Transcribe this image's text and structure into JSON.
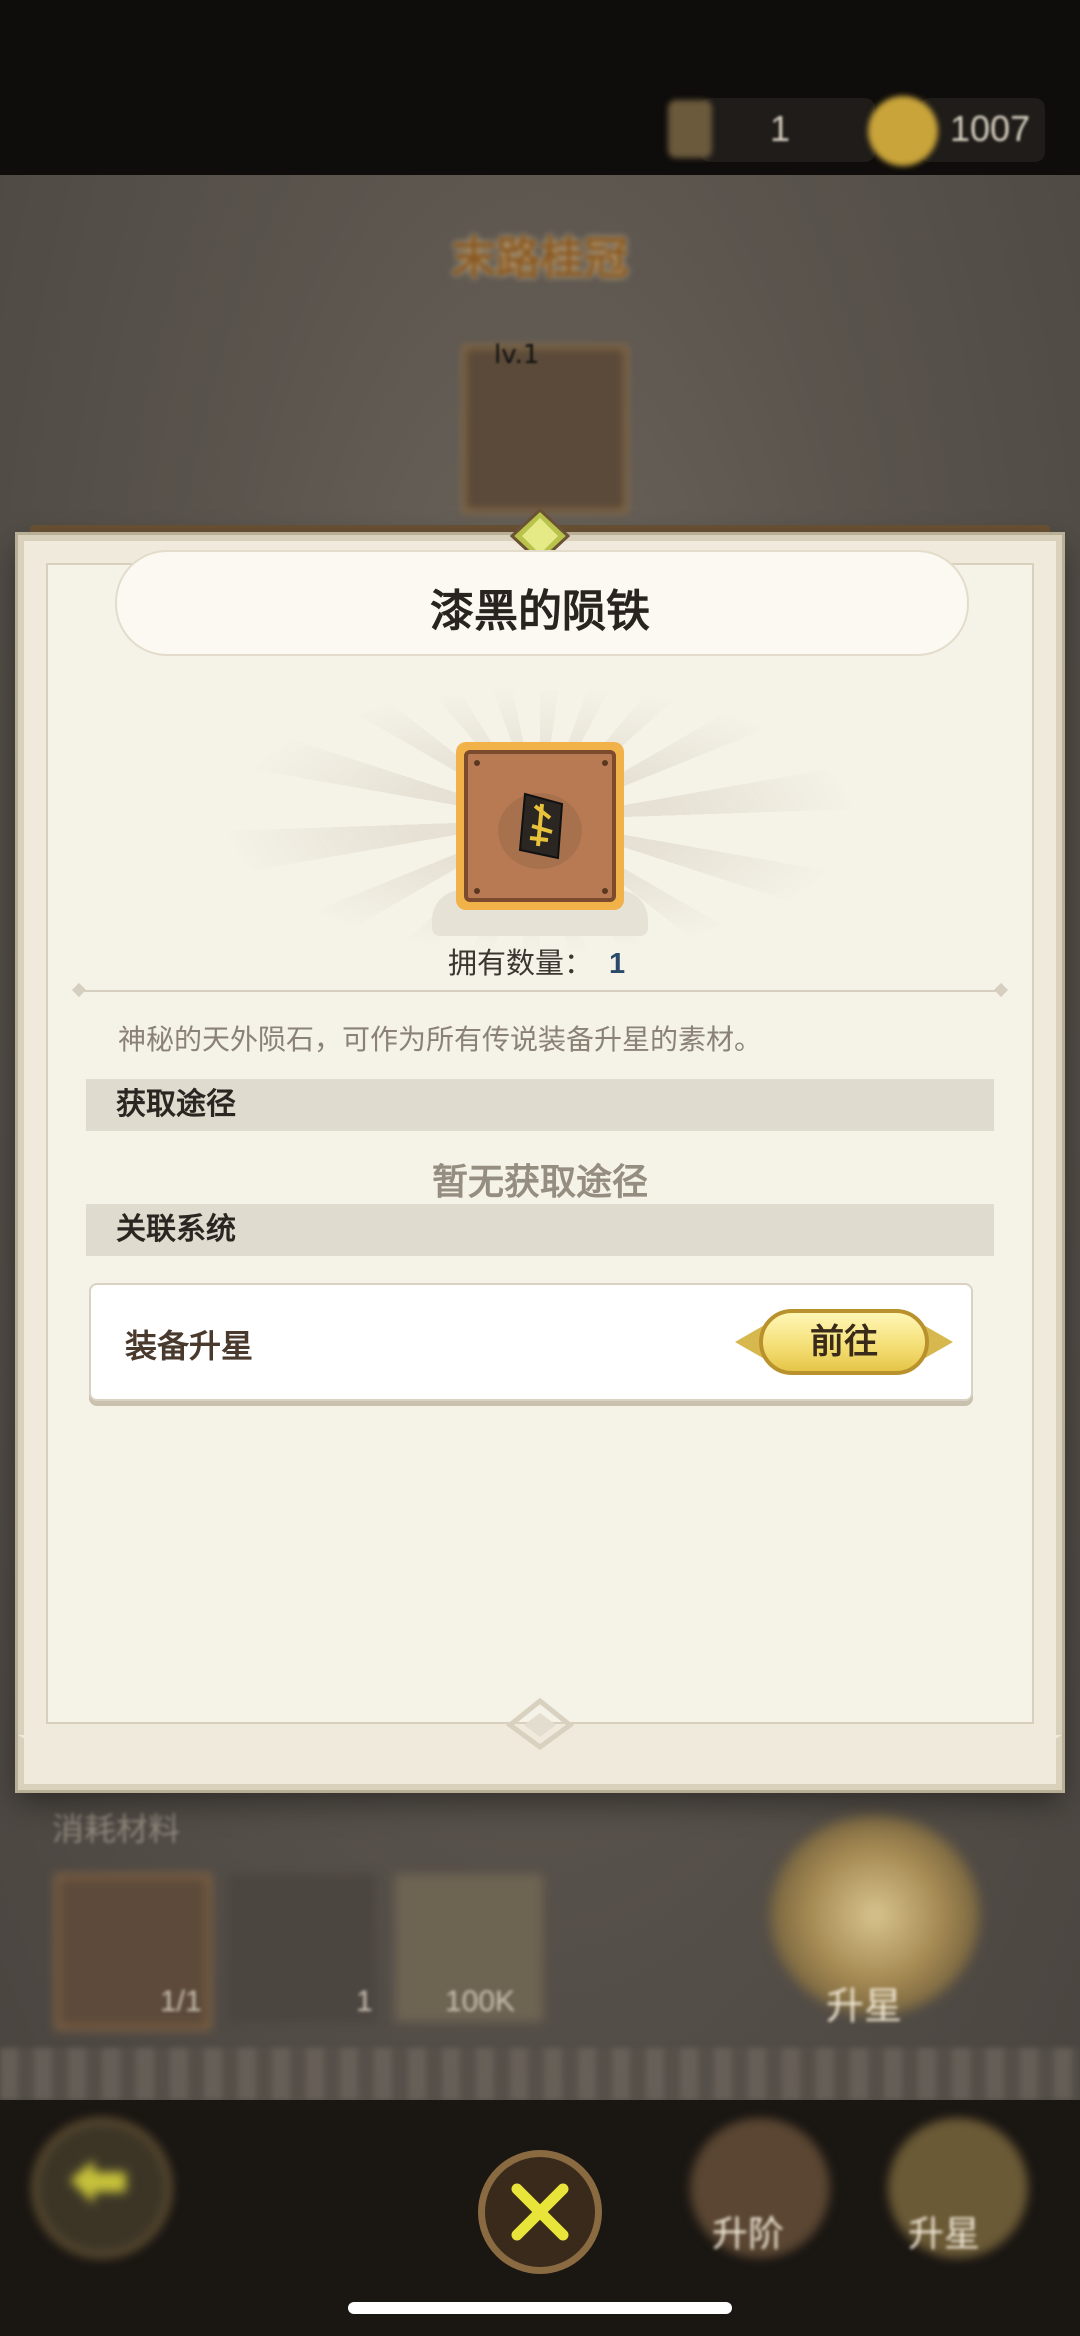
{
  "resources": [
    {
      "name": "stamina",
      "value": "1"
    },
    {
      "name": "coins",
      "value": "1007"
    }
  ],
  "background": {
    "title": "末路桂冠",
    "hero_level": "lv.1",
    "section_label": "消耗材料",
    "materials": [
      {
        "name": "hero-shard",
        "count": "1/1"
      },
      {
        "name": "meteorite",
        "count": "1"
      },
      {
        "name": "gold",
        "count": "100K"
      }
    ],
    "star_up_emblem_label": "升星"
  },
  "modal": {
    "title": "漆黑的陨铁",
    "owned_label": "拥有数量：",
    "owned_count": "1",
    "description": "神秘的天外陨石，可作为所有传说装备升星的素材。",
    "acquire_header": "获取途径",
    "acquire_empty": "暂无获取途径",
    "related_header": "关联系统",
    "related_items": [
      {
        "label": "装备升星",
        "button": "前往"
      }
    ]
  },
  "bottom_nav": {
    "back_icon": "arrow-back-icon",
    "close_icon": "close-x-icon",
    "advance_label": "升阶",
    "star_label": "升星"
  },
  "colors": {
    "panel": "#efeadb",
    "item_frame": "#f2b24a",
    "go_button": "#f5e078"
  }
}
